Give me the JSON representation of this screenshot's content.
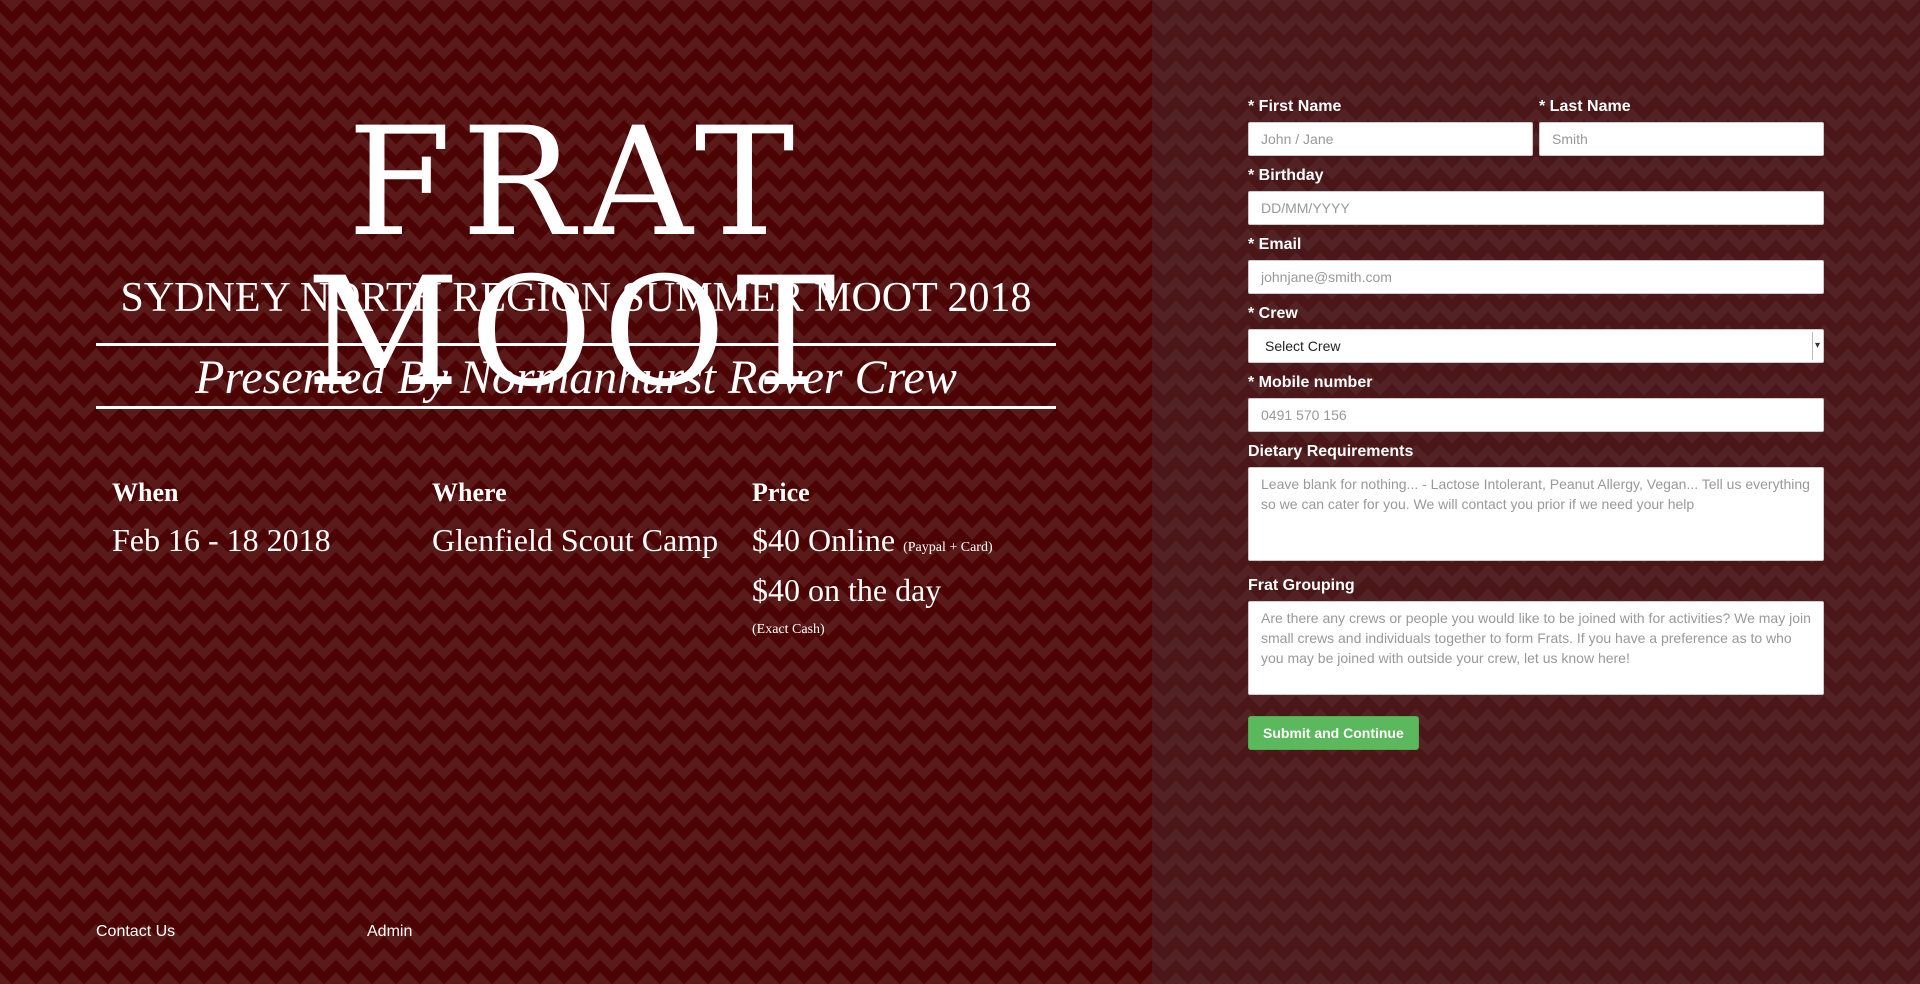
{
  "hero": {
    "title": "FRAT MOOT",
    "subtitle": "SYDNEY NORTH REGION SUMMER MOOT 2018",
    "presented_by": "Presented By Normanhurst Rover Crew"
  },
  "info": {
    "when": {
      "heading": "When",
      "value": "Feb 16 - 18 2018"
    },
    "where": {
      "heading": "Where",
      "value": "Glenfield Scout Camp"
    },
    "price": {
      "heading": "Price",
      "online": "$40 Online",
      "online_note": "(Paypal + Card)",
      "on_day": "$40 on the day",
      "on_day_note": "(Exact Cash)"
    }
  },
  "footer": {
    "contact": "Contact Us",
    "admin": "Admin"
  },
  "form": {
    "first_name": {
      "label": "* First Name",
      "placeholder": "John / Jane"
    },
    "last_name": {
      "label": "* Last Name",
      "placeholder": "Smith"
    },
    "birthday": {
      "label": "* Birthday",
      "placeholder": "DD/MM/YYYY"
    },
    "email": {
      "label": "* Email",
      "placeholder": "johnjane@smith.com"
    },
    "crew": {
      "label": "* Crew",
      "selected": "Select Crew"
    },
    "mobile": {
      "label": "* Mobile number",
      "placeholder": "0491 570 156"
    },
    "dietary": {
      "label": "Dietary Requirements",
      "placeholder": "Leave blank for nothing... - Lactose Intolerant, Peanut Allergy, Vegan... Tell us everything so we can cater for you. We will contact you prior if we need your help"
    },
    "frat_grouping": {
      "label": "Frat Grouping",
      "placeholder": "Are there any crews or people you would like to be joined with for activities? We may join small crews and individuals together to form Frats. If you have a preference as to who you may be joined with outside your crew, let us know here!"
    },
    "submit_label": "Submit and Continue"
  },
  "colors": {
    "left_bg": "#4b0303",
    "right_bg": "#4a1618",
    "submit_green": "#5cb85c"
  }
}
